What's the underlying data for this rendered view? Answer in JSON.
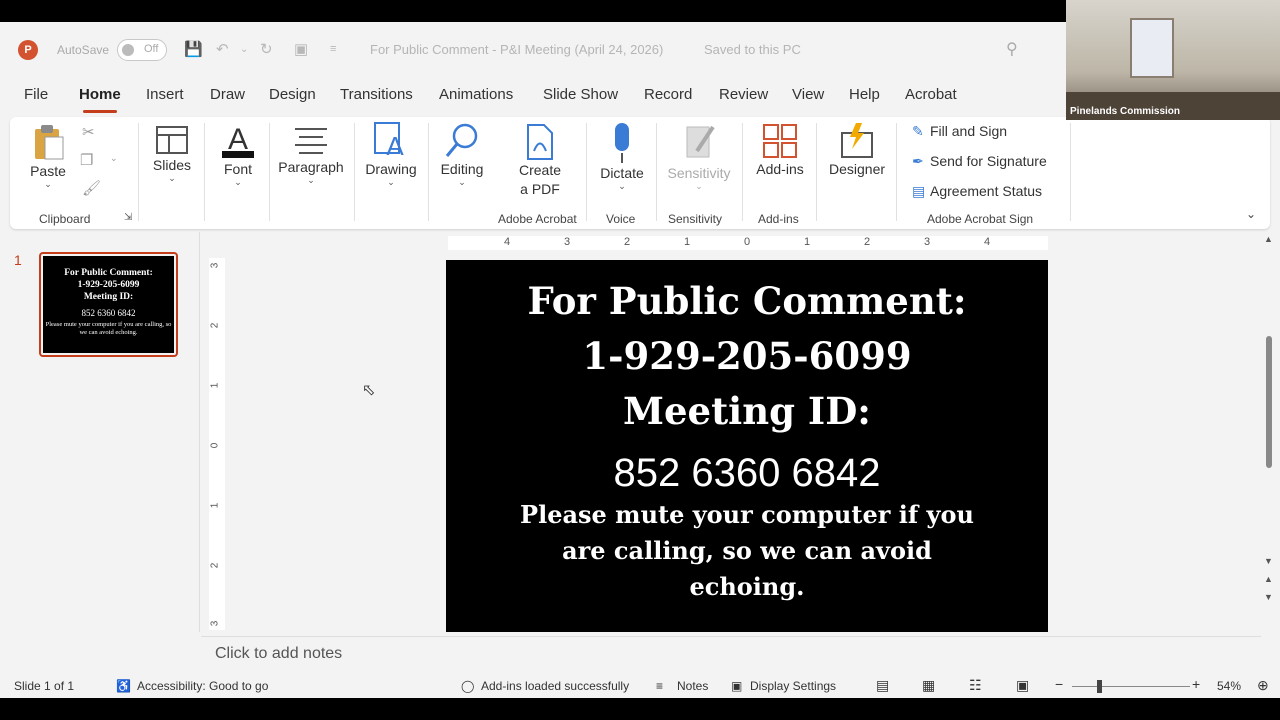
{
  "titlebar": {
    "autosave_label": "AutoSave",
    "autosave_state": "Off",
    "doc_title": "For Public Comment - P&I Meeting (April 24, 2026)",
    "saved_status": "Saved to this PC",
    "app_icon": "P"
  },
  "tabs": [
    "File",
    "Home",
    "Insert",
    "Draw",
    "Design",
    "Transitions",
    "Animations",
    "Slide Show",
    "Record",
    "Review",
    "View",
    "Help",
    "Acrobat"
  ],
  "active_tab": "Home",
  "ribbon": {
    "paste": "Paste",
    "clipboard": "Clipboard",
    "slides": "Slides",
    "font": "Font",
    "paragraph": "Paragraph",
    "drawing": "Drawing",
    "editing": "Editing",
    "create_pdf_1": "Create",
    "create_pdf_2": "a PDF",
    "adobe_acrobat": "Adobe Acrobat",
    "dictate": "Dictate",
    "voice": "Voice",
    "sensitivity": "Sensitivity",
    "sensitivity_group": "Sensitivity",
    "addins": "Add-ins",
    "addins_group": "Add-ins",
    "designer": "Designer",
    "fill_sign": "Fill and Sign",
    "send_signature": "Send for Signature",
    "agreement_status": "Agreement Status",
    "adobe_sign_group": "Adobe Acrobat Sign"
  },
  "thumbnail": {
    "number": "1",
    "line1": "For Public Comment:",
    "line2": "1-929-205-6099",
    "line3": "Meeting ID:",
    "line4": "852 6360 6842",
    "line5": "Please mute your computer if you are calling, so we can avoid echoing."
  },
  "slide": {
    "line1": "For Public Comment:",
    "line2": "1-929-205-6099",
    "line3": "Meeting ID:",
    "meeting_id": "852 6360 6842",
    "note": "Please mute your computer if you are calling, so we can avoid echoing."
  },
  "ruler_h": [
    "4",
    "3",
    "2",
    "1",
    "0",
    "1",
    "2",
    "3",
    "4"
  ],
  "ruler_v": [
    "3",
    "2",
    "1",
    "0",
    "1",
    "2",
    "3"
  ],
  "notes_placeholder": "Click to add notes",
  "status": {
    "slide": "Slide 1 of 1",
    "accessibility": "Accessibility: Good to go",
    "addins": "Add-ins loaded successfully",
    "notes": "Notes",
    "display": "Display Settings",
    "zoom": "54%"
  },
  "video": {
    "name": "Pinelands Commission"
  }
}
